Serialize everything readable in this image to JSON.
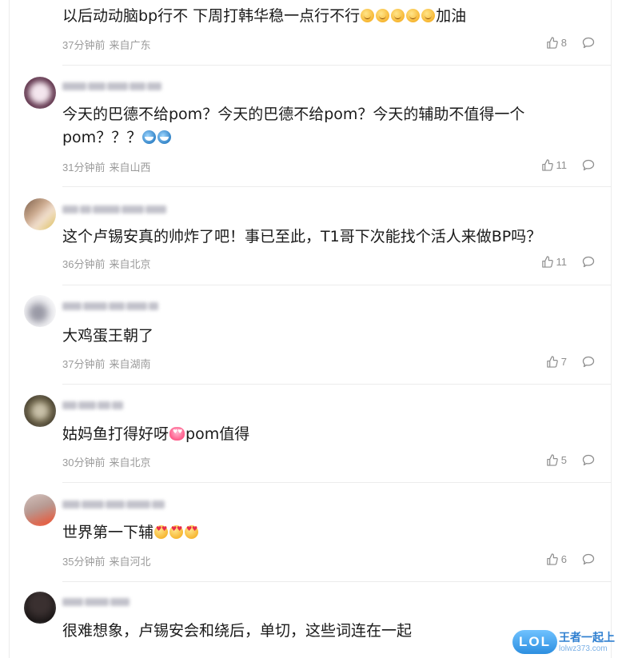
{
  "comments": [
    {
      "text_parts": [
        "以后动动脑bp行不 下周打韩华稳一点行不行",
        "",
        "加油"
      ],
      "emoji_row": [
        "smile",
        "smile",
        "smile",
        "smile",
        "smile"
      ],
      "time": "37分钟前",
      "location": "来自广东",
      "likes": "8"
    },
    {
      "text": "今天的巴德不给pom？今天的巴德不给pom？今天的辅助不值得一个pom？？？",
      "emoji_row": [
        "shark",
        "shark"
      ],
      "time": "31分钟前",
      "location": "来自山西",
      "likes": "11"
    },
    {
      "text": "这个卢锡安真的帅炸了吧！事已至此，T1哥下次能找个活人来做BP吗？",
      "time": "36分钟前",
      "location": "来自北京",
      "likes": "11"
    },
    {
      "text": "大鸡蛋王朝了",
      "time": "37分钟前",
      "location": "来自湖南",
      "likes": "7"
    },
    {
      "text_before": "姑妈鱼打得好呀",
      "text_after": "pom值得",
      "emoji_row": [
        "hearteyes"
      ],
      "time": "30分钟前",
      "location": "来自北京",
      "likes": "5"
    },
    {
      "text": "世界第一下辅",
      "emoji_row": [
        "heart",
        "heart",
        "heart"
      ],
      "time": "35分钟前",
      "location": "来自河北",
      "likes": "6"
    },
    {
      "text": "很难想象，卢锡安会和绕后，单切，这些词连在一起"
    }
  ],
  "icons": {
    "like": "thumbs-up-icon",
    "reply": "comment-bubble-icon"
  },
  "colors": {
    "text": "#1a1a1a",
    "meta": "#9a9a9a",
    "divider": "#ececec",
    "watermark_blue": "#2d8fe0"
  },
  "watermark": {
    "logo": "LOL",
    "title": "王者一起上",
    "url": "lolwz373.com"
  }
}
